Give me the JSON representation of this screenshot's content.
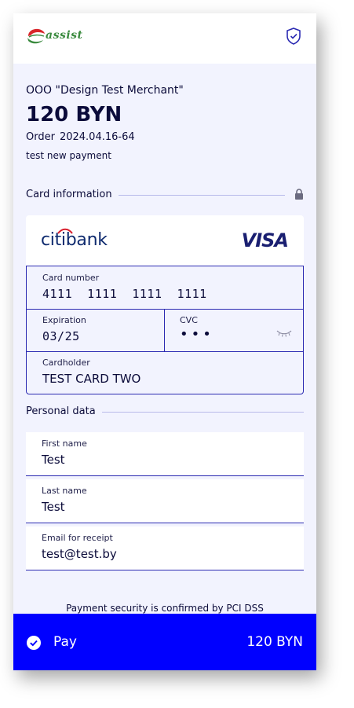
{
  "header": {
    "logo_text": "assist",
    "shield_icon": "shield-check-icon"
  },
  "payment": {
    "merchant": "OOO \"Design Test Merchant\"",
    "amount": "120 BYN",
    "order_label": "Order",
    "order_number": "2024.04.16-64",
    "description": "test new payment"
  },
  "card_section": {
    "title": "Card information",
    "bank_name_citi": "citi",
    "bank_name_rest": "bank",
    "brand": "VISA",
    "card_number_label": "Card number",
    "card_number": "4111  1111  1111  1111",
    "expiration_label": "Expiration",
    "expiration": "03/25",
    "cvc_label": "CVC",
    "cvc_masked": "•••",
    "cardholder_label": "Cardholder",
    "cardholder": "TEST CARD TWO"
  },
  "personal_section": {
    "title": "Personal data",
    "first_name_label": "First name",
    "first_name": "Test",
    "last_name_label": "Last name",
    "last_name": "Test",
    "email_label": "Email for receipt",
    "email": "test@test.by"
  },
  "footer": {
    "security_text": "Payment security is confirmed by PCI DSS",
    "pay_label": "Pay",
    "pay_amount": "120 BYN"
  },
  "colors": {
    "accent": "#0000ff",
    "border": "#2b2ab2",
    "background": "#f2f3fe",
    "text": "#0b0b3a"
  }
}
